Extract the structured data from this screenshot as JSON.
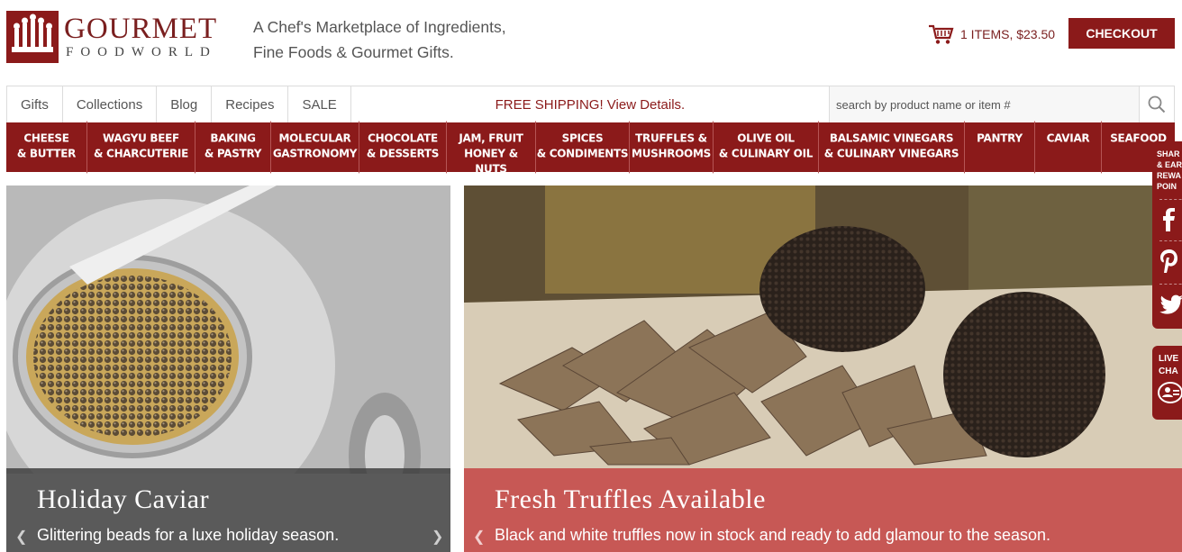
{
  "brand": {
    "name_line1": "GOURMET",
    "name_line2": "FOODWORLD",
    "tagline_line1": "A Chef's Marketplace of Ingredients,",
    "tagline_line2": "Fine Foods & Gourmet Gifts."
  },
  "cart": {
    "summary": "1 ITEMS, $23.50",
    "checkout_label": "CHECKOUT"
  },
  "subnav": {
    "items": [
      {
        "label": "Gifts"
      },
      {
        "label": "Collections"
      },
      {
        "label": "Blog"
      },
      {
        "label": "Recipes"
      },
      {
        "label": "SALE"
      }
    ],
    "promo": "FREE SHIPPING! View Details.",
    "search_placeholder": "search by product name or item #"
  },
  "categories": [
    {
      "line1": "Cheese",
      "line2": "& Butter"
    },
    {
      "line1": "Wagyu Beef",
      "line2": "& Charcuterie"
    },
    {
      "line1": "Baking",
      "line2": "& Pastry"
    },
    {
      "line1": "Molecular",
      "line2": "Gastronomy"
    },
    {
      "line1": "Chocolate",
      "line2": "& Desserts"
    },
    {
      "line1": "Jam, Fruit",
      "line2": "Honey & Nuts"
    },
    {
      "line1": "Spices",
      "line2": "& Condiments"
    },
    {
      "line1": "Truffles &",
      "line2": "Mushrooms"
    },
    {
      "line1": "Olive Oil",
      "line2": "& Culinary Oil"
    },
    {
      "line1": "Balsamic Vinegars",
      "line2": "& Culinary Vinegars"
    },
    {
      "line1": "Pantry",
      "line2": ""
    },
    {
      "line1": "Caviar",
      "line2": ""
    },
    {
      "line1": "Seafood",
      "line2": ""
    }
  ],
  "heroes": [
    {
      "title": "Holiday Caviar",
      "subtitle": "Glittering beads for a luxe holiday season."
    },
    {
      "title": "Fresh Truffles Available",
      "subtitle": "Black and white truffles now in stock and ready to add glamour to the season."
    }
  ],
  "side": {
    "share_line1": "SHAR",
    "share_line2": "& EAR",
    "share_line3": "REWA",
    "share_line4": "POIN",
    "chat_line1": "LIVE",
    "chat_line2": "CHA"
  },
  "colors": {
    "brand_red": "#8b1a1a",
    "caption_red": "#c44848",
    "caption_dark": "#3c3c3c"
  },
  "icons": {
    "logo": "crown-logo-icon",
    "cart": "cart-icon",
    "search": "search-icon",
    "facebook": "facebook-icon",
    "pinterest": "pinterest-icon",
    "twitter": "twitter-icon",
    "chat": "chat-icon",
    "arrow_left": "chevron-left-icon",
    "arrow_right": "chevron-right-icon"
  }
}
